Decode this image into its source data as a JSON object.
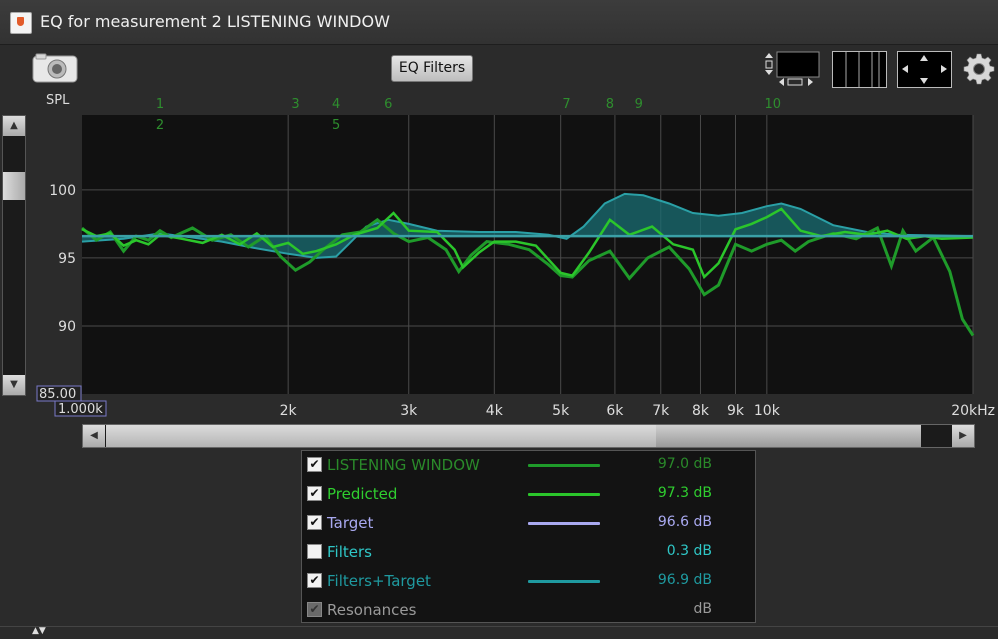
{
  "window": {
    "title": "EQ for measurement 2 LISTENING WINDOW"
  },
  "toolbar": {
    "eq_filters_label": "EQ Filters"
  },
  "graph": {
    "y_label": "SPL",
    "y_ticks": [
      "100",
      "95",
      "90"
    ],
    "y_min_label": "85.00",
    "x_start_label": "1.000k",
    "x_ticks": [
      "2k",
      "3k",
      "4k",
      "5k",
      "6k",
      "7k",
      "8k",
      "9k",
      "10k",
      "20kHz"
    ],
    "filter_markers": [
      "1",
      "2",
      "3",
      "4",
      "5",
      "6",
      "7",
      "8",
      "9",
      "10"
    ],
    "colors": {
      "background": "#111111",
      "grid": "#4a4a4a",
      "listening_window": "#1f9b2a",
      "predicted": "#29c629",
      "filters_target_fill": "#1a6e73",
      "filters_target_line": "#2aa0a6",
      "target": "#6aa9a9",
      "marker_text": "#2e8e2e"
    }
  },
  "legend": {
    "items": [
      {
        "checked": true,
        "name": "LISTENING WINDOW",
        "value": "97.0 dB",
        "color": "#2a8a2a",
        "line": "#1f9b2a"
      },
      {
        "checked": true,
        "name": "Predicted",
        "value": "97.3 dB",
        "color": "#2fce2f",
        "line": "#2bc62b"
      },
      {
        "checked": true,
        "name": "Target",
        "value": "96.6 dB",
        "color": "#a9a9f0",
        "line": "#a9a9f0"
      },
      {
        "checked": false,
        "name": "Filters",
        "value": "0.3 dB",
        "color": "#2fc7c7",
        "line": ""
      },
      {
        "checked": true,
        "name": "Filters+Target",
        "value": "96.9 dB",
        "color": "#1f9aa0",
        "line": "#1f9aa0"
      },
      {
        "checked": true,
        "name": "Resonances",
        "value": "dB",
        "color": "#9a9a9a",
        "line": "",
        "disabled": true
      }
    ]
  }
}
